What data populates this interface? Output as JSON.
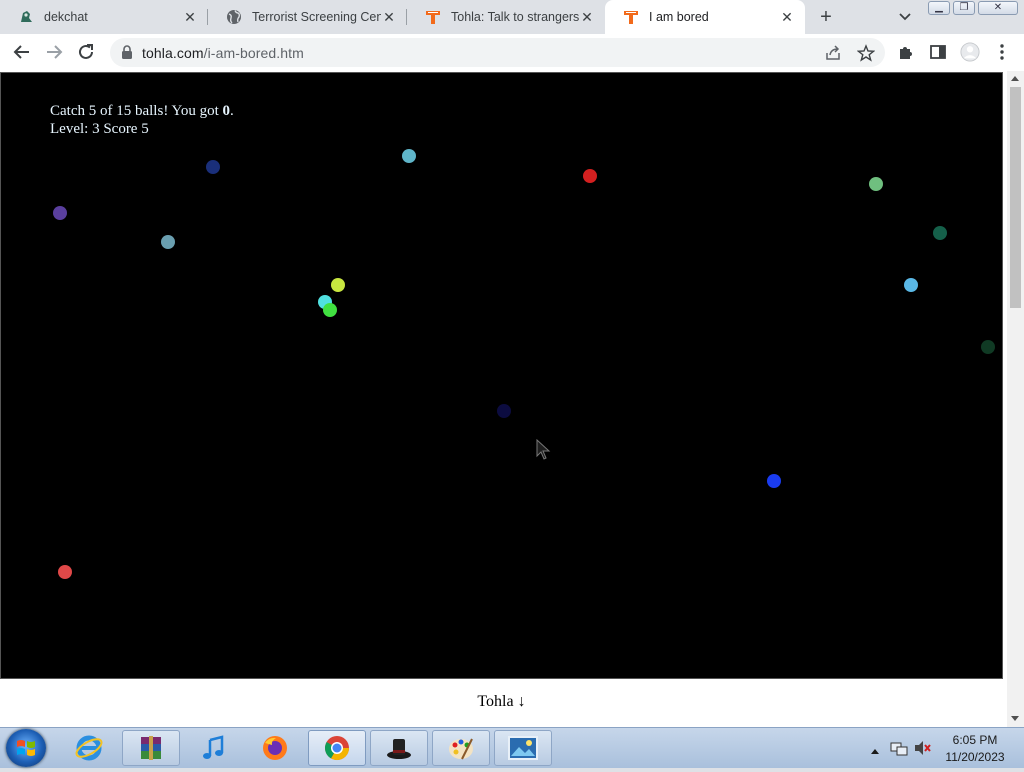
{
  "browser": {
    "tabs": [
      {
        "title": "dekchat",
        "icon": "dekchat-favicon-icon",
        "active": false
      },
      {
        "title": "Terrorist Screening Cente",
        "icon": "globe-icon",
        "active": false
      },
      {
        "title": "Tohla: Talk to strangers",
        "icon": "tohla-favicon-icon",
        "active": false
      },
      {
        "title": "I am bored",
        "icon": "tohla-favicon-icon",
        "active": true
      }
    ],
    "new_tab_label": "+",
    "url_domain": "tohla.com",
    "url_path": "/i-am-bored.htm"
  },
  "game": {
    "catch_text": "Catch 5 of 15 balls! You got ",
    "caught_count": "0",
    "catch_suffix": ".",
    "level_text": "Level: 3 Score 5",
    "balls": [
      {
        "color": "#1a2f7a"
      },
      {
        "color": "#5fb5c9"
      },
      {
        "color": "#d42020"
      },
      {
        "color": "#6fbf7f"
      },
      {
        "color": "#5a3f9e"
      },
      {
        "color": "#6a9fb0"
      },
      {
        "color": "#15604a"
      },
      {
        "color": "#c8e640"
      },
      {
        "color": "#50e0e0"
      },
      {
        "color": "#40e040"
      },
      {
        "color": "#5ab8e6"
      },
      {
        "color": "#103a24"
      },
      {
        "color": "#0c0c40"
      },
      {
        "color": "#1a3cf0"
      },
      {
        "color": "#e04848"
      }
    ]
  },
  "footer": {
    "link_text": "Tohla ↓"
  },
  "taskbar": {
    "items": [
      "internet-explorer-icon",
      "winrar-icon",
      "itunes-icon",
      "firefox-icon",
      "chrome-icon",
      "top-hat-icon",
      "paint-icon",
      "photo-viewer-icon"
    ],
    "time": "6:05 PM",
    "date": "11/20/2023"
  },
  "colors": {
    "accent": "#1a73e8",
    "game_bg": "#000000",
    "game_text": "#e8f6ff"
  }
}
